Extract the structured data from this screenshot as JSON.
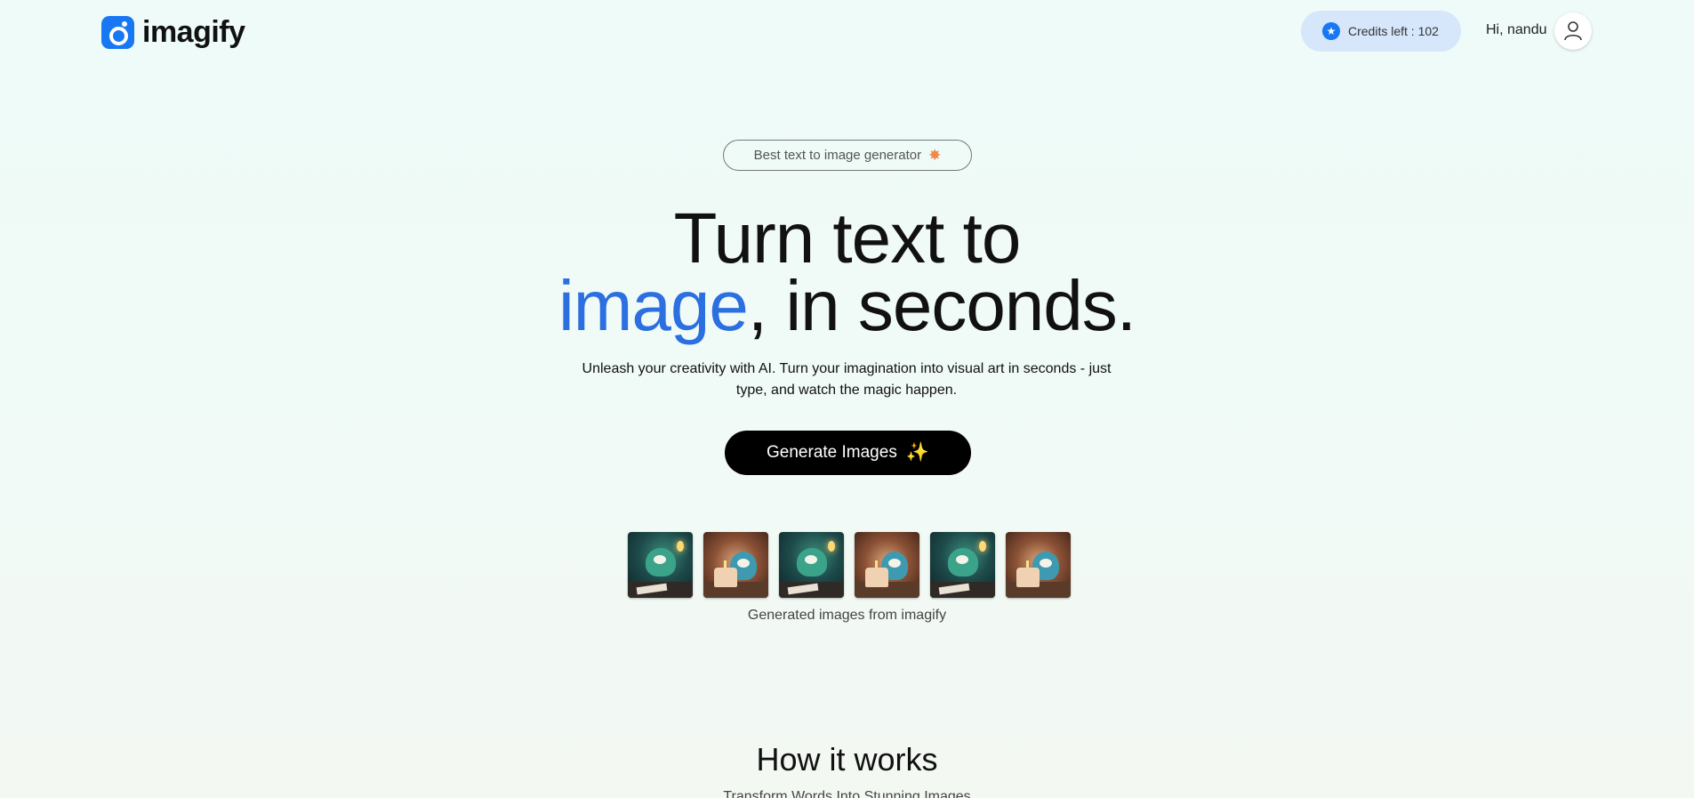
{
  "header": {
    "logo_text": "imagify",
    "credits_label": "Credits left : 102",
    "greeting": "Hi, nandu"
  },
  "hero": {
    "badge": "Best text to image generator",
    "headline_line1": "Turn text to",
    "headline_accent": "image",
    "headline_rest": ", in seconds.",
    "subtitle": "Unleash your creativity with AI. Turn your imagination into visual art in seconds - just type, and watch the magic happen.",
    "cta_label": "Generate Images",
    "gallery_caption": "Generated images from imagify"
  },
  "how_it_works": {
    "title": "How it works",
    "subtitle": "Transform Words Into Stunning Images"
  },
  "colors": {
    "accent": "#2b6fe0",
    "brand": "#1877f2",
    "cta_bg": "#000000",
    "credits_bg": "#d6e6fb"
  },
  "icons": {
    "logo": "imagify-logo-icon",
    "credits": "star-icon",
    "avatar": "user-icon",
    "badge": "star-burst-icon",
    "cta": "sparkles-icon"
  }
}
